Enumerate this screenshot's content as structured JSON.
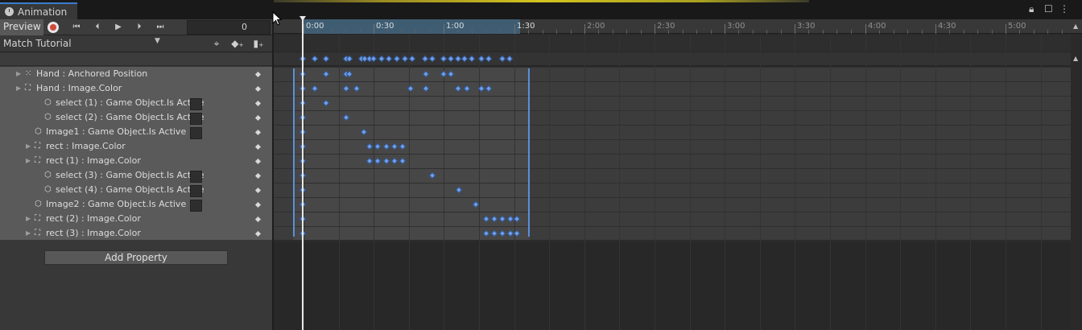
{
  "window": {
    "tab_title": "Animation"
  },
  "toolbar": {
    "preview_label": "Preview",
    "frame_value": "0",
    "buttons": [
      {
        "name": "first-key-button",
        "glyph": "⏮"
      },
      {
        "name": "prev-key-button",
        "glyph": "⏴"
      },
      {
        "name": "play-button",
        "glyph": "▶"
      },
      {
        "name": "next-key-button",
        "glyph": "⏵"
      },
      {
        "name": "last-key-button",
        "glyph": "⏭"
      }
    ]
  },
  "clip": {
    "selected": "Match Tutorial"
  },
  "properties": [
    {
      "label": "Hand : Anchored Position",
      "indent": 0,
      "arrow": true,
      "icon": "move-icon",
      "checkbox": false
    },
    {
      "label": "Hand : Image.Color",
      "indent": 0,
      "arrow": true,
      "icon": "image-icon",
      "checkbox": false
    },
    {
      "label": "select (1) : Game Object.Is Active",
      "indent": 2,
      "arrow": false,
      "icon": "cube-icon",
      "checkbox": true
    },
    {
      "label": "select (2) : Game Object.Is Active",
      "indent": 2,
      "arrow": false,
      "icon": "cube-icon",
      "checkbox": true
    },
    {
      "label": "Image1 : Game Object.Is Active",
      "indent": 1,
      "arrow": false,
      "icon": "cube-icon",
      "checkbox": true
    },
    {
      "label": "rect : Image.Color",
      "indent": 1,
      "arrow": true,
      "icon": "image-icon",
      "checkbox": false
    },
    {
      "label": "rect (1) : Image.Color",
      "indent": 1,
      "arrow": true,
      "icon": "image-icon",
      "checkbox": false
    },
    {
      "label": "select (3) : Game Object.Is Active",
      "indent": 2,
      "arrow": false,
      "icon": "cube-icon",
      "checkbox": true
    },
    {
      "label": "select (4) : Game Object.Is Active",
      "indent": 2,
      "arrow": false,
      "icon": "cube-icon",
      "checkbox": true
    },
    {
      "label": "Image2 : Game Object.Is Active",
      "indent": 1,
      "arrow": false,
      "icon": "cube-icon",
      "checkbox": true
    },
    {
      "label": "rect (2) : Image.Color",
      "indent": 1,
      "arrow": true,
      "icon": "image-icon",
      "checkbox": false
    },
    {
      "label": "rect (3) : Image.Color",
      "indent": 1,
      "arrow": true,
      "icon": "image-icon",
      "checkbox": false
    }
  ],
  "add_property_label": "Add Property",
  "timeline": {
    "ruler_labels": [
      "0:00",
      "0:30",
      "1:00",
      "1:30",
      "2:00",
      "2:30",
      "3:00",
      "3:30",
      "4:00",
      "4:30",
      "5:00"
    ],
    "clip_end_label": "1:30"
  },
  "keyframes": {
    "summary": [
      0,
      0.5,
      1,
      1.85,
      2,
      2.5,
      2.65,
      2.85,
      3,
      3.35,
      3.65,
      4,
      4.35,
      4.65,
      5.2,
      5.5,
      6,
      6.3,
      6.6,
      6.9,
      7.2,
      7.6,
      7.9,
      8.5,
      8.8
    ],
    "rows": [
      [
        0,
        1,
        1.85,
        2,
        5.25,
        6,
        6.3
      ],
      [
        0,
        0.5,
        1.85,
        2.3,
        4.6,
        5.25,
        6.6,
        7,
        7.6,
        7.9
      ],
      [
        0,
        1
      ],
      [
        0,
        1.85
      ],
      [
        0,
        2.6
      ],
      [
        0,
        2.85,
        3.2,
        3.55,
        3.9,
        4.25
      ],
      [
        0,
        2.85,
        3.2,
        3.55,
        3.9,
        4.25
      ],
      [
        0,
        5.5
      ],
      [
        0,
        6.65
      ],
      [
        0,
        7.35
      ],
      [
        0,
        7.8,
        8.15,
        8.5,
        8.85,
        9.1
      ],
      [
        0,
        7.8,
        8.15,
        8.5,
        8.85,
        9.1
      ]
    ]
  },
  "colors": {
    "accent": "#3c7ccf",
    "record": "#d04a3a",
    "keyframe": "#6f9de6",
    "range": "#3f5d72"
  }
}
